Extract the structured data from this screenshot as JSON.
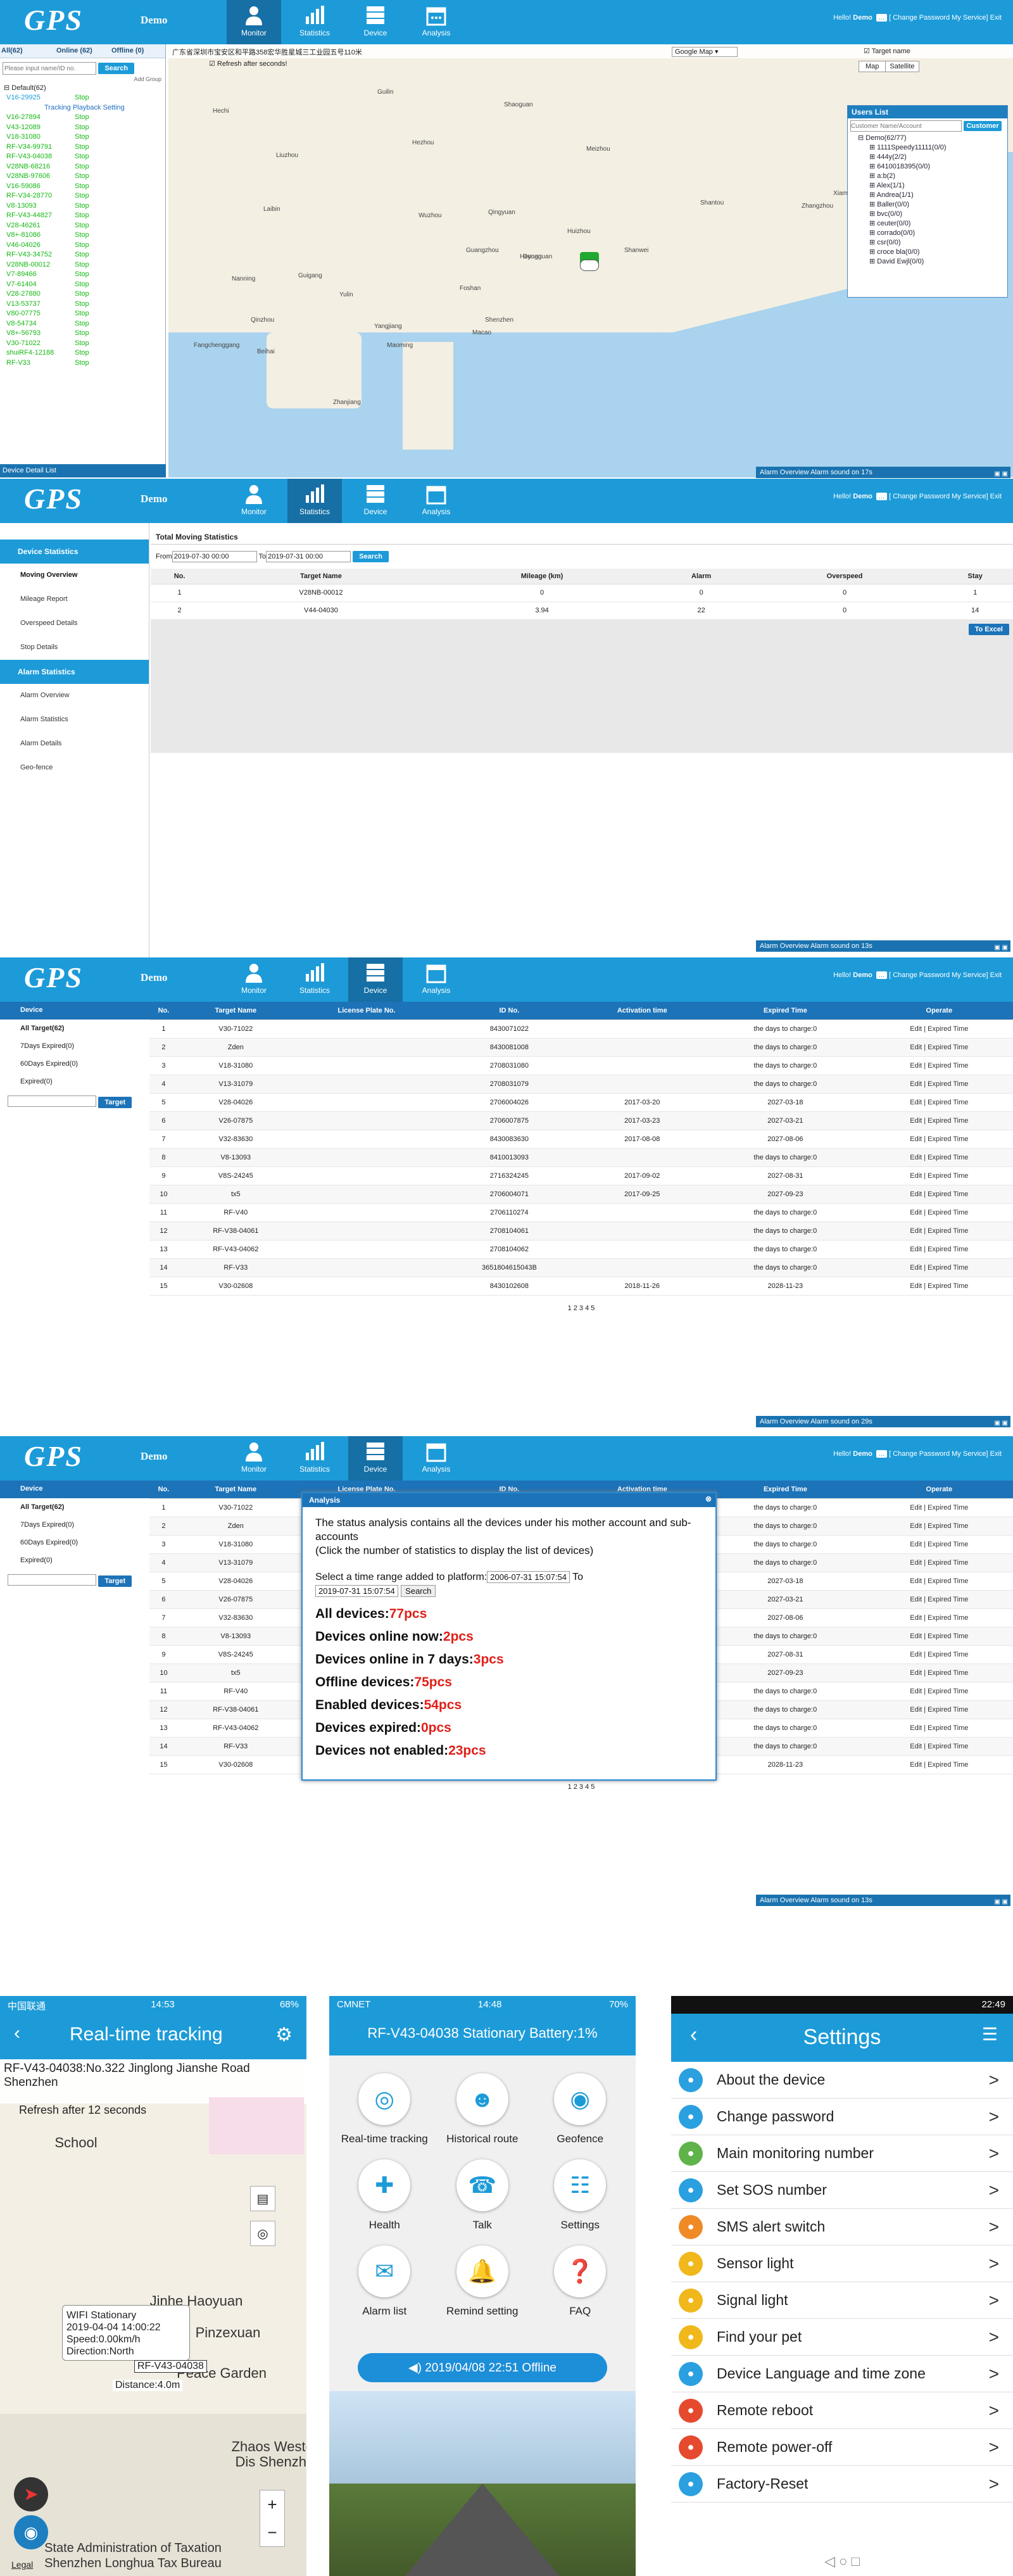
{
  "brand": {
    "logo": "GPS",
    "account": "Demo"
  },
  "nav": [
    "Monitor",
    "Statistics",
    "Device",
    "Analysis"
  ],
  "topright": {
    "hello": "Hello!",
    "user": "Demo",
    "badge": "...",
    "links": "[ Change Password  My Service] Exit"
  },
  "monitor": {
    "tabs": [
      "All(62)",
      "Online (62)",
      "Offline (0)"
    ],
    "search_placeholder": "Please input name/ID no.",
    "search_btn": "Search",
    "add_group": "Add Group",
    "group": "Default(62)",
    "playback": "Tracking Playback Setting",
    "devices": [
      [
        "V16-29925",
        "Stop"
      ],
      [
        "",
        "Tracking Playback Setting"
      ],
      [
        "V16-27894",
        "Stop"
      ],
      [
        "V43-12089",
        "Stop"
      ],
      [
        "V18-31080",
        "Stop"
      ],
      [
        "RF-V34-99791",
        "Stop"
      ],
      [
        "RF-V43-04038",
        "Stop"
      ],
      [
        "V28NB-68216",
        "Stop"
      ],
      [
        "V28NB-97606",
        "Stop"
      ],
      [
        "V16-59086",
        "Stop"
      ],
      [
        "RF-V34-28770",
        "Stop"
      ],
      [
        "V8-13093",
        "Stop"
      ],
      [
        "RF-V43-44827",
        "Stop"
      ],
      [
        "V28-46261",
        "Stop"
      ],
      [
        "V8+-81086",
        "Stop"
      ],
      [
        "V46-04026",
        "Stop"
      ],
      [
        "RF-V43-34752",
        "Stop"
      ],
      [
        "V28NB-00012",
        "Stop"
      ],
      [
        "V7-89466",
        "Stop"
      ],
      [
        "V7-61404",
        "Stop"
      ],
      [
        "V28-27880",
        "Stop"
      ],
      [
        "V13-53737",
        "Stop"
      ],
      [
        "V80-07775",
        "Stop"
      ],
      [
        "V8-54734",
        "Stop"
      ],
      [
        "V8+-56793",
        "Stop"
      ],
      [
        "V30-71022",
        "Stop"
      ],
      [
        "shuiRF4-12188",
        "Stop"
      ],
      [
        "RF-V33",
        "Stop"
      ]
    ],
    "address": "广东省深圳市宝安区和平路358宏华胜星城三工业园五号110米",
    "refresh": "Refresh after seconds!",
    "map_select": "Google Map",
    "target_name": "Target name",
    "map_btn": "Map",
    "satellite_btn": "Satellite",
    "users_title": "Users List",
    "customer_placeholder": "Customer Name/Account",
    "customer_btn": "Customer",
    "users": [
      "Demo(62/77)",
      "1111Speedy11111(0/0)",
      "444y(2/2)",
      "6410018395(0/0)",
      "a:b(2)",
      "Alex(1/1)",
      "Andrea(1/1)",
      "Baller(0/0)",
      "bvc(0/0)",
      "ceuter(0/0)",
      "corrado(0/0)",
      "csr(0/0)",
      "croce bla(0/0)",
      "David Ewjl(0/0)"
    ],
    "cities": [
      "Hechi",
      "Guilin",
      "Hezhou",
      "Shaoguan",
      "Heyuan",
      "Meizhou",
      "Liuzhou",
      "Laibin",
      "Wuzhou",
      "Qingyuan",
      "Guangzhou",
      "Huizhou",
      "Shanwei",
      "Shantou",
      "Nanning",
      "Guigang",
      "Yulin",
      "Foshan",
      "Dongguan",
      "Shenzhen",
      "Macao",
      "Qinzhou",
      "Beihai",
      "Maoming",
      "Yangjiang",
      "Zhanjiang",
      "Xiamen",
      "Zhangzhou",
      "Fangchenggang"
    ],
    "detail_bar": "Device Detail List",
    "alarm_bar": "Alarm Overview  Alarm sound on 17s"
  },
  "stats": {
    "side_head1": "Device Statistics",
    "side_items1": [
      "Moving Overview",
      "Mileage Report",
      "Overspeed Details",
      "Stop Details"
    ],
    "side_head2": "Alarm Statistics",
    "side_items2": [
      "Alarm Overview",
      "Alarm Statistics",
      "Alarm Details",
      "Geo-fence"
    ],
    "title": "Total Moving Statistics",
    "from_label": "From",
    "from": "2019-07-30 00:00",
    "to_label": "To",
    "to": "2019-07-31 00:00",
    "search": "Search",
    "cols": [
      "No.",
      "Target Name",
      "Mileage (km)",
      "Alarm",
      "Overspeed",
      "Stay"
    ],
    "rows": [
      [
        "1",
        "V28NB-00012",
        "0",
        "0",
        "0",
        "1"
      ],
      [
        "2",
        "V44-04030",
        "3.94",
        "22",
        "0",
        "14"
      ]
    ],
    "excel": "To Excel",
    "alarm_bar": "Alarm Overview  Alarm sound on 13s"
  },
  "device": {
    "side_head": "Device",
    "side_items": [
      "All Target(62)",
      "7Days Expired(0)",
      "60Days Expired(0)",
      "Expired(0)"
    ],
    "target_btn": "Target",
    "cols": [
      "No.",
      "Target Name",
      "License Plate No.",
      "ID No.",
      "Activation time",
      "Expired Time",
      "Operate"
    ],
    "rows": [
      [
        "1",
        "V30-71022",
        "",
        "8430071022",
        "",
        "the days to charge:0",
        "Edit | Expired Time"
      ],
      [
        "2",
        "Zden",
        "",
        "8430081008",
        "",
        "the days to charge:0",
        "Edit | Expired Time"
      ],
      [
        "3",
        "V18-31080",
        "",
        "2708031080",
        "",
        "the days to charge:0",
        "Edit | Expired Time"
      ],
      [
        "4",
        "V13-31079",
        "",
        "2708031079",
        "",
        "the days to charge:0",
        "Edit | Expired Time"
      ],
      [
        "5",
        "V28-04026",
        "",
        "2706004026",
        "2017-03-20",
        "2027-03-18",
        "Edit | Expired Time"
      ],
      [
        "6",
        "V26-07875",
        "",
        "2706007875",
        "2017-03-23",
        "2027-03-21",
        "Edit | Expired Time"
      ],
      [
        "7",
        "V32-83630",
        "",
        "8430083630",
        "2017-08-08",
        "2027-08-06",
        "Edit | Expired Time"
      ],
      [
        "8",
        "V8-13093",
        "",
        "8410013093",
        "",
        "the days to charge:0",
        "Edit | Expired Time"
      ],
      [
        "9",
        "V8S-24245",
        "",
        "2716324245",
        "2017-09-02",
        "2027-08-31",
        "Edit | Expired Time"
      ],
      [
        "10",
        "tx5",
        "",
        "2706004071",
        "2017-09-25",
        "2027-09-23",
        "Edit | Expired Time"
      ],
      [
        "11",
        "RF-V40",
        "",
        "2706110274",
        "",
        "the days to charge:0",
        "Edit | Expired Time"
      ],
      [
        "12",
        "RF-V38-04061",
        "",
        "2708104061",
        "",
        "the days to charge:0",
        "Edit | Expired Time"
      ],
      [
        "13",
        "RF-V43-04062",
        "",
        "2708104062",
        "",
        "the days to charge:0",
        "Edit | Expired Time"
      ],
      [
        "14",
        "RF-V33",
        "",
        "3651804615043B",
        "",
        "the days to charge:0",
        "Edit | Expired Time"
      ],
      [
        "15",
        "V30-02608",
        "",
        "8430102608",
        "2018-11-26",
        "2028-11-23",
        "Edit | Expired Time"
      ]
    ],
    "pager": "1 2 3 4 5",
    "alarm_bar": "Alarm Overview  Alarm sound on 29s"
  },
  "analysis": {
    "title": "Analysis",
    "desc": "The status analysis contains all the devices under his mother account and sub-accounts",
    "desc2": "(Click the number of statistics to display the list of devices)",
    "range_label": "Select a time range added to platform:",
    "from": "2006-07-31 15:07:54",
    "to_label": "To",
    "to": "2019-07-31 15:07:54",
    "search": "Search",
    "stats": [
      [
        "All devices:",
        "77pcs"
      ],
      [
        "Devices online now:",
        "2pcs"
      ],
      [
        "Devices online in 7 days:",
        "3pcs"
      ],
      [
        "Offline devices:",
        "75pcs"
      ],
      [
        "Enabled devices:",
        "54pcs"
      ],
      [
        "Devices expired:",
        "0pcs"
      ],
      [
        "Devices not enabled:",
        "23pcs"
      ]
    ],
    "alarm_bar": "Alarm Overview  Alarm sound on 13s"
  },
  "phone1": {
    "status_l": "中国联通",
    "time": "14:53",
    "status_r": "68%",
    "title": "Real-time tracking",
    "addr": "RF-V43-04038:No.322 Jinglong Jianshe Road Shenzhen",
    "refresh": "Refresh after 12 seconds",
    "info": [
      "WIFI Stationary",
      "2019-04-04 14:00:22",
      "Speed:0.00km/h",
      "Direction:North"
    ],
    "marker": "RF-V43-04038",
    "distance": "Distance:4.0m",
    "places": [
      "Jinhe Haoyuan",
      "Pinzexuan",
      "Peace Garden",
      "School",
      "State Administration of Taxation Shenzhen Longhua Tax Bureau",
      "Zhaos Western Dis Shenzhen"
    ],
    "legal": "Legal"
  },
  "phone2": {
    "status_l": "CMNET",
    "time": "14:48",
    "status_r": "70%",
    "title": "RF-V43-04038 Stationary Battery:1%",
    "items": [
      "Real-time tracking",
      "Historical route",
      "Geofence",
      "Health",
      "Talk",
      "Settings",
      "Alarm list",
      "Remind setting",
      "FAQ"
    ],
    "banner": "2019/04/08 22:51 Offline"
  },
  "phone3": {
    "time": "22:49",
    "title": "Settings",
    "items": [
      "About the device",
      "Change password",
      "Main monitoring number",
      "Set SOS number",
      "SMS alert switch",
      "Sensor light",
      "Signal light",
      "Find your pet",
      "Device Language and time zone",
      "Remote reboot",
      "Remote power-off",
      "Factory-Reset"
    ],
    "colors": [
      "#2aa0e0",
      "#2aa0e0",
      "#5fb34a",
      "#2aa0e0",
      "#f08a24",
      "#f0b81a",
      "#f0b81a",
      "#f0b81a",
      "#2aa0e0",
      "#e64a2e",
      "#e64a2e",
      "#2aa0e0"
    ]
  }
}
